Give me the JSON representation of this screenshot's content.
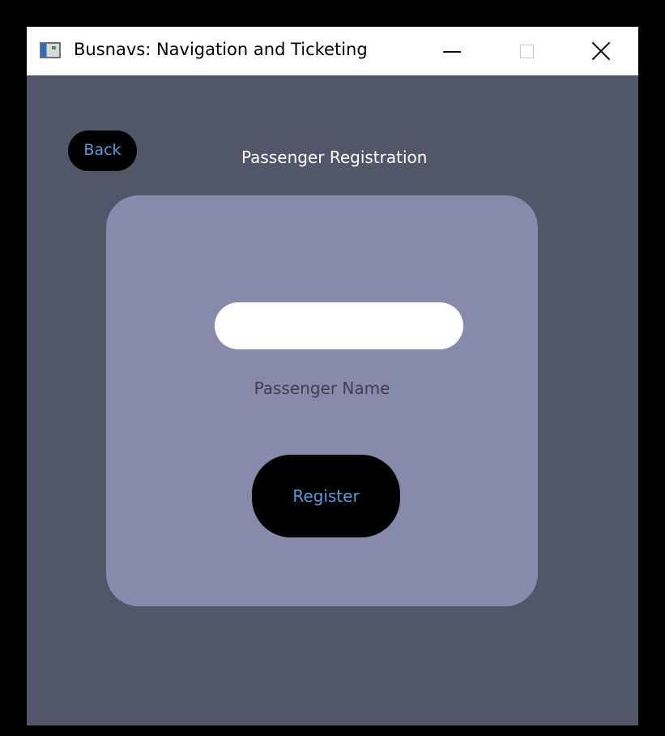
{
  "window": {
    "title": "Busnavs: Navigation and Ticketing",
    "icon": "app-window-icon",
    "controls": {
      "minimize": "minimize-icon",
      "maximize": "maximize-icon",
      "close": "close-icon"
    }
  },
  "page": {
    "back_label": "Back",
    "title": "Passenger Registration"
  },
  "form": {
    "name_value": "",
    "name_label": "Passenger Name",
    "register_label": "Register"
  },
  "colors": {
    "window_background": "#525669",
    "card_background": "#878aab",
    "button_background": "#000000",
    "button_text": "#4f9de0",
    "title_text": "#ffffff",
    "label_text": "#3d3f4f"
  }
}
